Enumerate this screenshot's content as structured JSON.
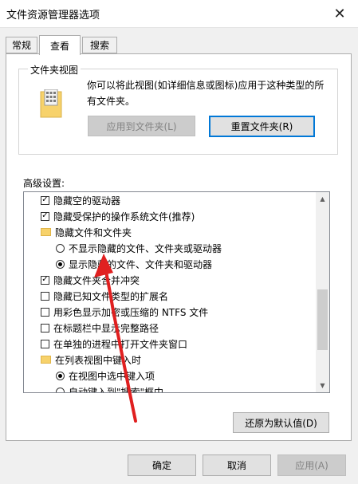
{
  "window": {
    "title": "文件资源管理器选项"
  },
  "tabs": [
    "常规",
    "查看",
    "搜索"
  ],
  "folder_view": {
    "group_title": "文件夹视图",
    "description": "你可以将此视图(如详细信息或图标)应用于这种类型的所有文件夹。",
    "apply_button": "应用到文件夹(L)",
    "reset_button": "重置文件夹(R)"
  },
  "advanced": {
    "label": "高级设置:",
    "items": [
      {
        "type": "checkbox",
        "checked": true,
        "label": "隐藏空的驱动器"
      },
      {
        "type": "checkbox",
        "checked": true,
        "label": "隐藏受保护的操作系统文件(推荐)"
      },
      {
        "type": "folder",
        "label": "隐藏文件和文件夹"
      },
      {
        "type": "radio",
        "selected": false,
        "label": "不显示隐藏的文件、文件夹或驱动器"
      },
      {
        "type": "radio",
        "selected": true,
        "label": "显示隐藏的文件、文件夹和驱动器"
      },
      {
        "type": "checkbox",
        "checked": true,
        "label": "隐藏文件夹合并冲突"
      },
      {
        "type": "checkbox",
        "checked": false,
        "label": "隐藏已知文件类型的扩展名"
      },
      {
        "type": "checkbox",
        "checked": false,
        "label": "用彩色显示加密或压缩的 NTFS 文件"
      },
      {
        "type": "checkbox",
        "checked": false,
        "label": "在标题栏中显示完整路径"
      },
      {
        "type": "checkbox",
        "checked": false,
        "label": "在单独的进程中打开文件夹窗口"
      },
      {
        "type": "folder",
        "label": "在列表视图中键入时"
      },
      {
        "type": "radio",
        "selected": true,
        "label": "在视图中选中键入项"
      },
      {
        "type": "radio",
        "selected": false,
        "label": "自动键入到\"搜索\"框中"
      }
    ],
    "restore_button": "还原为默认值(D)"
  },
  "footer": {
    "ok": "确定",
    "cancel": "取消",
    "apply": "应用(A)"
  },
  "colors": {
    "accent": "#0078d7",
    "arrow": "#e02020"
  }
}
